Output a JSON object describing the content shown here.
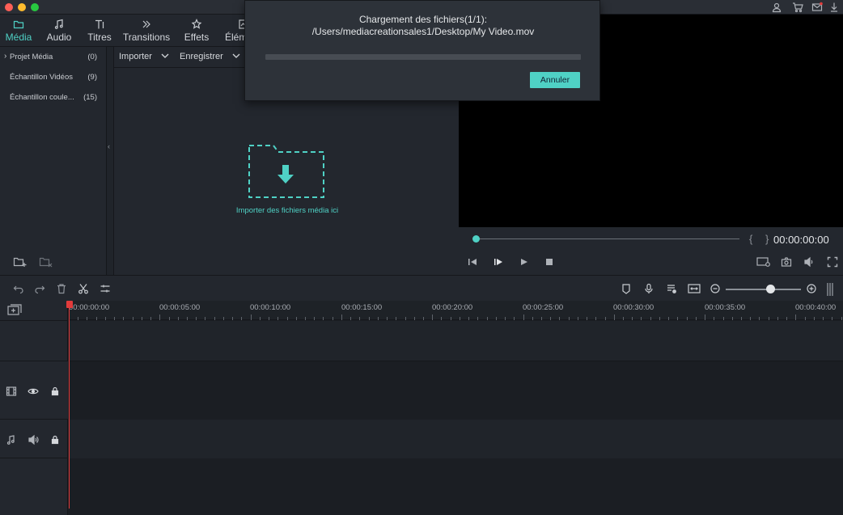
{
  "window": {
    "traffic_lights": [
      "#fe5f57",
      "#febc2e",
      "#28c840"
    ]
  },
  "top_icons": [
    "user-icon",
    "cart-icon",
    "mail-icon",
    "download-icon"
  ],
  "tabs": [
    {
      "label": "Média",
      "icon": "folder-icon",
      "active": true
    },
    {
      "label": "Audio",
      "icon": "music-note-icon",
      "active": false
    },
    {
      "label": "Titres",
      "icon": "text-icon",
      "active": false
    },
    {
      "label": "Transitions",
      "icon": "transition-icon",
      "active": false
    },
    {
      "label": "Effets",
      "icon": "effects-icon",
      "active": false
    },
    {
      "label": "Élém",
      "icon": "elements-icon",
      "active": false
    }
  ],
  "media_sidebar": {
    "items": [
      {
        "label": "Projet Média",
        "count": "(0)"
      },
      {
        "label": "Échantillon Vidéos",
        "count": "(9)"
      },
      {
        "label": "Échantillon coule...",
        "count": "(15)"
      }
    ]
  },
  "media_toolbar": {
    "import_label": "Importer",
    "record_label": "Enregistrer"
  },
  "drop_zone": {
    "label": "Importer des fichiers média ici"
  },
  "dialog": {
    "title_line1": "Chargement des fichiers(1/1):",
    "title_line2": "/Users/mediacreationsales1/Desktop/My Video.mov",
    "cancel_label": "Annuler",
    "progress": 0
  },
  "preview": {
    "timecode": "00:00:00:00",
    "braces": "{ }",
    "position": 0
  },
  "timeline": {
    "ruler": [
      "00:00:00:00",
      "00:00:05:00",
      "00:00:10:00",
      "00:00:15:00",
      "00:00:20:00",
      "00:00:25:00",
      "00:00:30:00",
      "00:00:35:00",
      "00:00:40:00"
    ],
    "zoom_level": 0.55
  },
  "colors": {
    "accent": "#4fd1c5",
    "playhead": "#e23b3b"
  }
}
